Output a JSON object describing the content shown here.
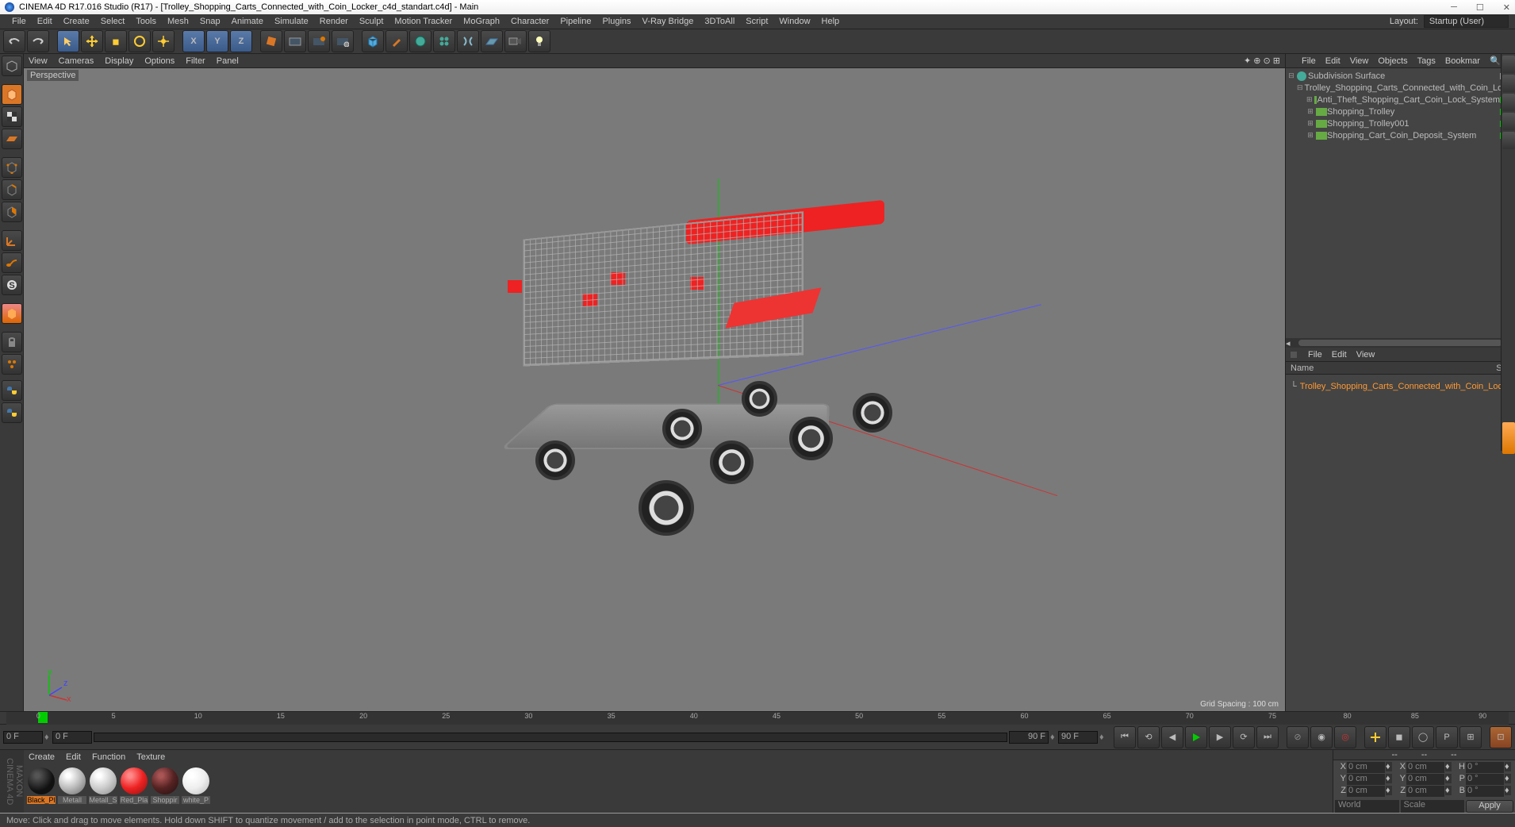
{
  "titlebar": {
    "app": "CINEMA 4D R17.016 Studio (R17)",
    "doc": "[Trolley_Shopping_Carts_Connected_with_Coin_Locker_c4d_standart.c4d]",
    "suffix": "Main"
  },
  "menubar": {
    "items": [
      "File",
      "Edit",
      "Create",
      "Select",
      "Tools",
      "Mesh",
      "Snap",
      "Animate",
      "Simulate",
      "Render",
      "Sculpt",
      "Motion Tracker",
      "MoGraph",
      "Character",
      "Pipeline",
      "Plugins",
      "V-Ray Bridge",
      "3DToAll",
      "Script",
      "Window",
      "Help"
    ],
    "layout_label": "Layout:",
    "layout_value": "Startup (User)"
  },
  "viewtabs": [
    "View",
    "Cameras",
    "Display",
    "Options",
    "Filter",
    "Panel"
  ],
  "viewport": {
    "label": "Perspective",
    "grid": "Grid Spacing : 100 cm"
  },
  "objpanel": {
    "menu": [
      "File",
      "Edit",
      "View",
      "Objects",
      "Tags",
      "Bookmar"
    ],
    "root": "Subdivision Surface",
    "tree": [
      {
        "indent": 1,
        "label": "Trolley_Shopping_Carts_Connected_with_Coin_Locker"
      },
      {
        "indent": 2,
        "label": "Anti_Theft_Shopping_Cart_Coin_Lock_System"
      },
      {
        "indent": 2,
        "label": "Shopping_Trolley"
      },
      {
        "indent": 2,
        "label": "Shopping_Trolley001"
      },
      {
        "indent": 2,
        "label": "Shopping_Cart_Coin_Deposit_System"
      }
    ]
  },
  "proppanel": {
    "menu": [
      "File",
      "Edit",
      "View"
    ],
    "name_label": "Name",
    "sv": "S  V",
    "item": "Trolley_Shopping_Carts_Connected_with_Coin_Locker"
  },
  "timeline": {
    "ticks": [
      "0",
      "5",
      "10",
      "15",
      "20",
      "25",
      "30",
      "35",
      "40",
      "45",
      "50",
      "55",
      "60",
      "65",
      "70",
      "75",
      "80",
      "85",
      "90"
    ]
  },
  "transport": {
    "start": "0 F",
    "current": "0 F",
    "end": "90 F",
    "end2": "90 F"
  },
  "matmenu": [
    "Create",
    "Edit",
    "Function",
    "Texture"
  ],
  "materials": [
    {
      "name": "Black_Pl",
      "color": "#111",
      "sel": true
    },
    {
      "name": "Metall",
      "color": "#bbb"
    },
    {
      "name": "Metall_S",
      "color": "#ccc"
    },
    {
      "name": "Red_Pla",
      "color": "#e22"
    },
    {
      "name": "Shoppir",
      "color": "#522"
    },
    {
      "name": "white_P",
      "color": "#eee"
    }
  ],
  "coords": {
    "x": "0 cm",
    "y": "0 cm",
    "z": "0 cm",
    "sx": "0 cm",
    "sy": "0 cm",
    "sz": "0 cm",
    "h": "0 °",
    "p": "0 °",
    "b": "0 °",
    "world": "World",
    "scale": "Scale",
    "apply": "Apply"
  },
  "logo": "MAXON CINEMA 4D",
  "status": "Move: Click and drag to move elements. Hold down SHIFT to quantize movement / add to the selection in point mode, CTRL to remove.",
  "gizmo": {
    "x": "x",
    "y": "y",
    "z": "z"
  },
  "coordheaders": {
    "x": "X",
    "y": "Y",
    "z": "Z",
    "h": "H",
    "p": "P",
    "b": "B"
  },
  "dashes": {
    "a": "--",
    "b": "--",
    "c": "--"
  }
}
